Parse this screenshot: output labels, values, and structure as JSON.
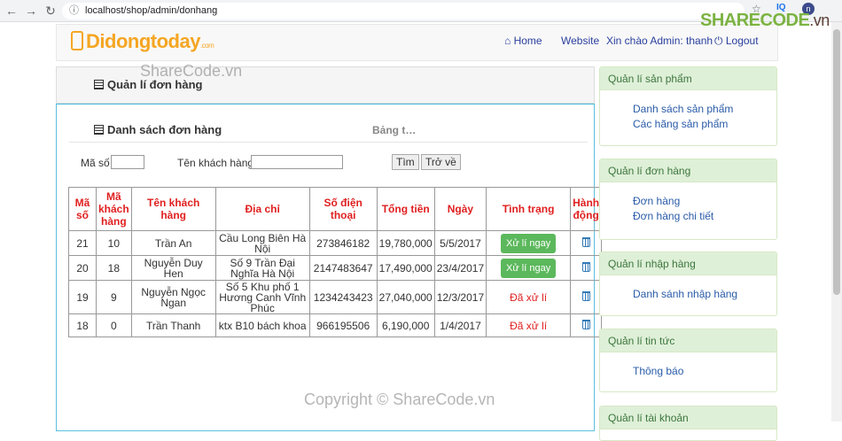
{
  "browser": {
    "url": "localhost/shop/admin/donhang",
    "icons": [
      "back-icon",
      "forward-icon",
      "reload-icon",
      "info-icon",
      "star-icon"
    ],
    "ext_label": "IQ",
    "profile_initial": "n"
  },
  "watermark": {
    "logo_main": "SHARECODE",
    "logo_suffix": ".vn",
    "top": "ShareCode.vn",
    "bottom": "Copyright © ShareCode.vn"
  },
  "header": {
    "brand": "Didongtoday",
    "brand_suffix": ".com",
    "home": "Home",
    "website": "Website",
    "greeting": "Xin chào Admin: thanh",
    "logout": "Logout"
  },
  "page": {
    "title": "Quản lí đơn hàng",
    "subtitle": "Danh sách đơn hàng",
    "subtitle_right": "Bảng t…"
  },
  "filter": {
    "code_label": "Mã số",
    "code_value": "",
    "name_label": "Tên khách hàng",
    "name_value": "",
    "search_btn": "Tìm",
    "back_btn": "Trở về"
  },
  "table": {
    "headers": [
      "Mã số",
      "Mã khách hàng",
      "Tên khách hàng",
      "Địa chỉ",
      "Số điện thoại",
      "Tổng tiền",
      "Ngày",
      "Tình trạng",
      "Hành động"
    ],
    "rows": [
      {
        "id": "21",
        "cust": "10",
        "name": "Trần An",
        "addr": "Cầu Long Biên Hà Nội",
        "phone": "273846182",
        "total": "19,780,000",
        "date": "5/5/2017",
        "status": "Xử lí ngay",
        "pending": true
      },
      {
        "id": "20",
        "cust": "18",
        "name": "Nguyễn Duy Hen",
        "addr": "Số 9 Trần Đại Nghĩa Hà Nội",
        "phone": "2147483647",
        "total": "17,490,000",
        "date": "23/4/2017",
        "status": "Xử lí ngay",
        "pending": true
      },
      {
        "id": "19",
        "cust": "9",
        "name": "Nguyễn Ngọc Ngan",
        "addr": "Số 5 Khu phố 1 Hương Canh Vĩnh Phúc",
        "phone": "1234243423",
        "total": "27,040,000",
        "date": "12/3/2017",
        "status": "Đã xử lí",
        "pending": false
      },
      {
        "id": "18",
        "cust": "0",
        "name": "Trần Thanh",
        "addr": "ktx B10 bách khoa",
        "phone": "966195506",
        "total": "6,190,000",
        "date": "1/4/2017",
        "status": "Đã xử lí",
        "pending": false
      }
    ]
  },
  "sidebar": [
    {
      "title": "Quản lí sản phẩm",
      "items": [
        "Danh sách sản phẩm",
        "Các hãng sản phẩm"
      ]
    },
    {
      "title": "Quản lí đơn hàng",
      "items": [
        "Đơn hàng",
        "Đơn hàng chi tiết"
      ]
    },
    {
      "title": "Quản lí nhập hàng",
      "items": [
        "Danh sánh nhập hàng"
      ]
    },
    {
      "title": "Quản lí tin tức",
      "items": [
        "Thông báo"
      ]
    },
    {
      "title": "Quản lí tài khoản",
      "items": []
    }
  ],
  "colors": {
    "brand": "#f5a623",
    "link": "#2a3f9d",
    "header_red": "#e02020",
    "success": "#5cb85c",
    "panel_green": "#dff0d8"
  }
}
